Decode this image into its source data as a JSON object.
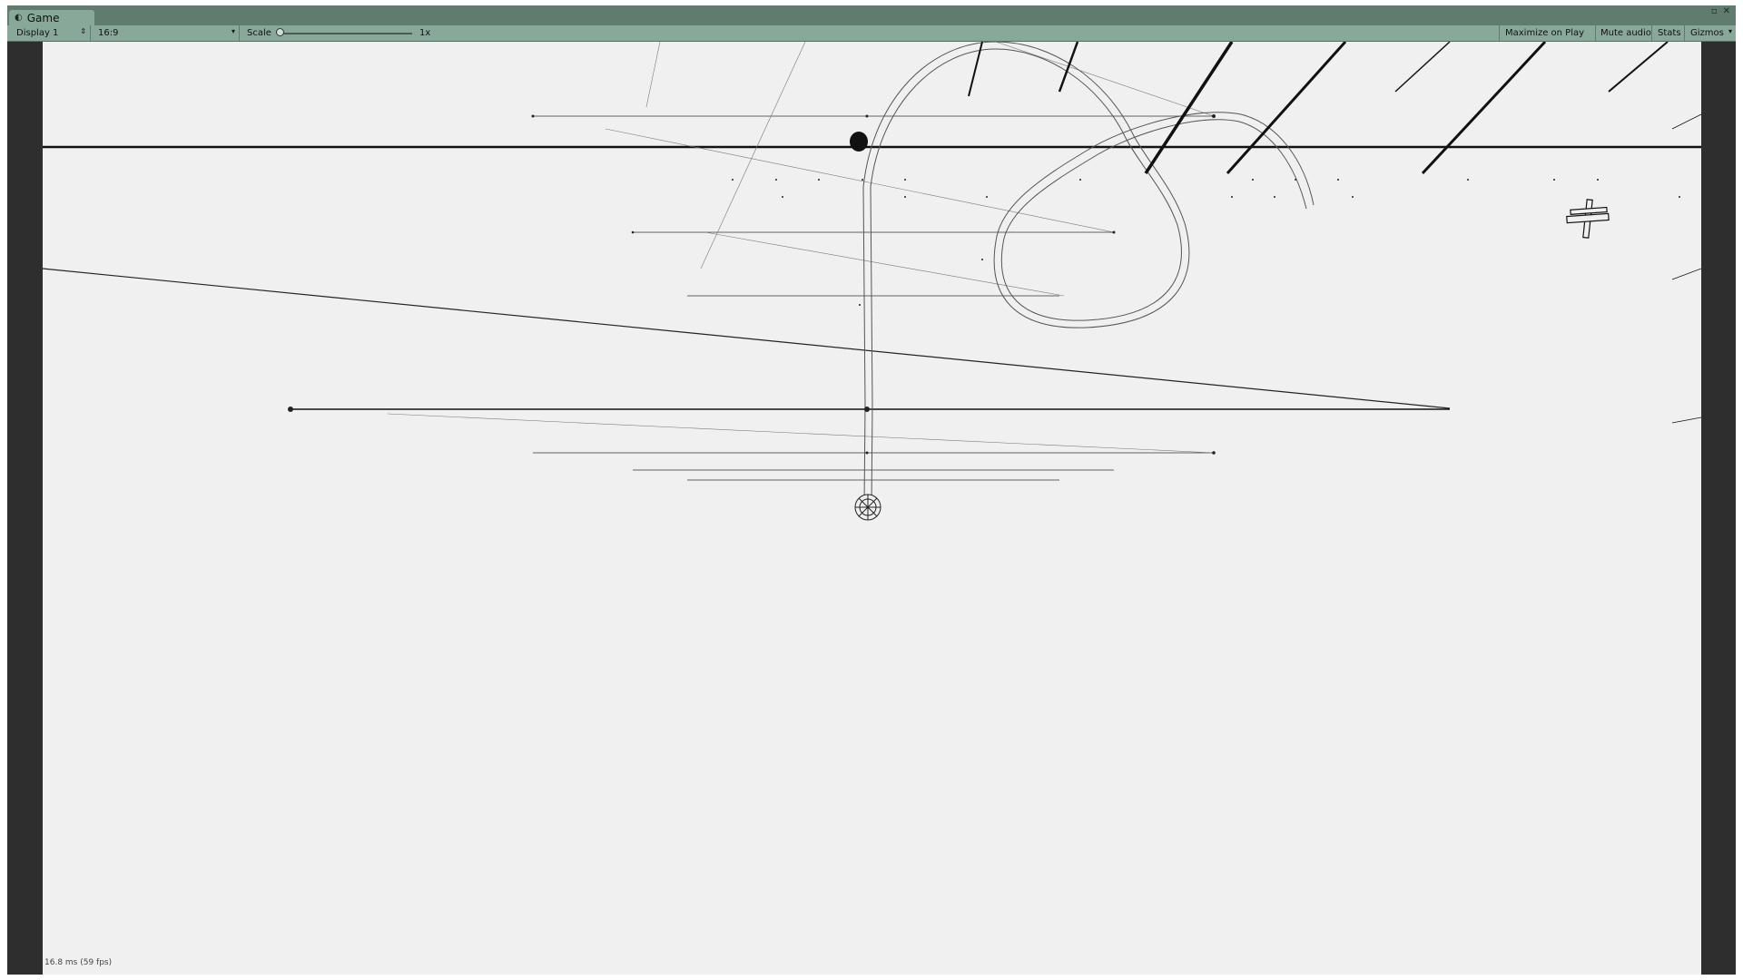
{
  "window": {
    "tab_title": "Game",
    "tab_icon": "game-view-icon",
    "controls": {
      "maximize_icon": "▫",
      "close_icon": "✕"
    }
  },
  "toolbar": {
    "display": {
      "label": "Display 1",
      "caret": "⇕"
    },
    "aspect": {
      "label": "16:9",
      "caret": "▾"
    },
    "scale": {
      "label": "Scale",
      "value": 1,
      "value_text": "1x"
    },
    "maximize_on_play": "Maximize on Play",
    "mute_audio": "Mute audio",
    "stats": "Stats",
    "gizmos": "Gizmos",
    "gizmos_caret": "▾"
  },
  "game": {
    "fps_text": "16.8 ms (59 fps)",
    "colors": {
      "background": "#f0f0f0",
      "ink": "#111111",
      "chrome": "#88a99a"
    }
  }
}
